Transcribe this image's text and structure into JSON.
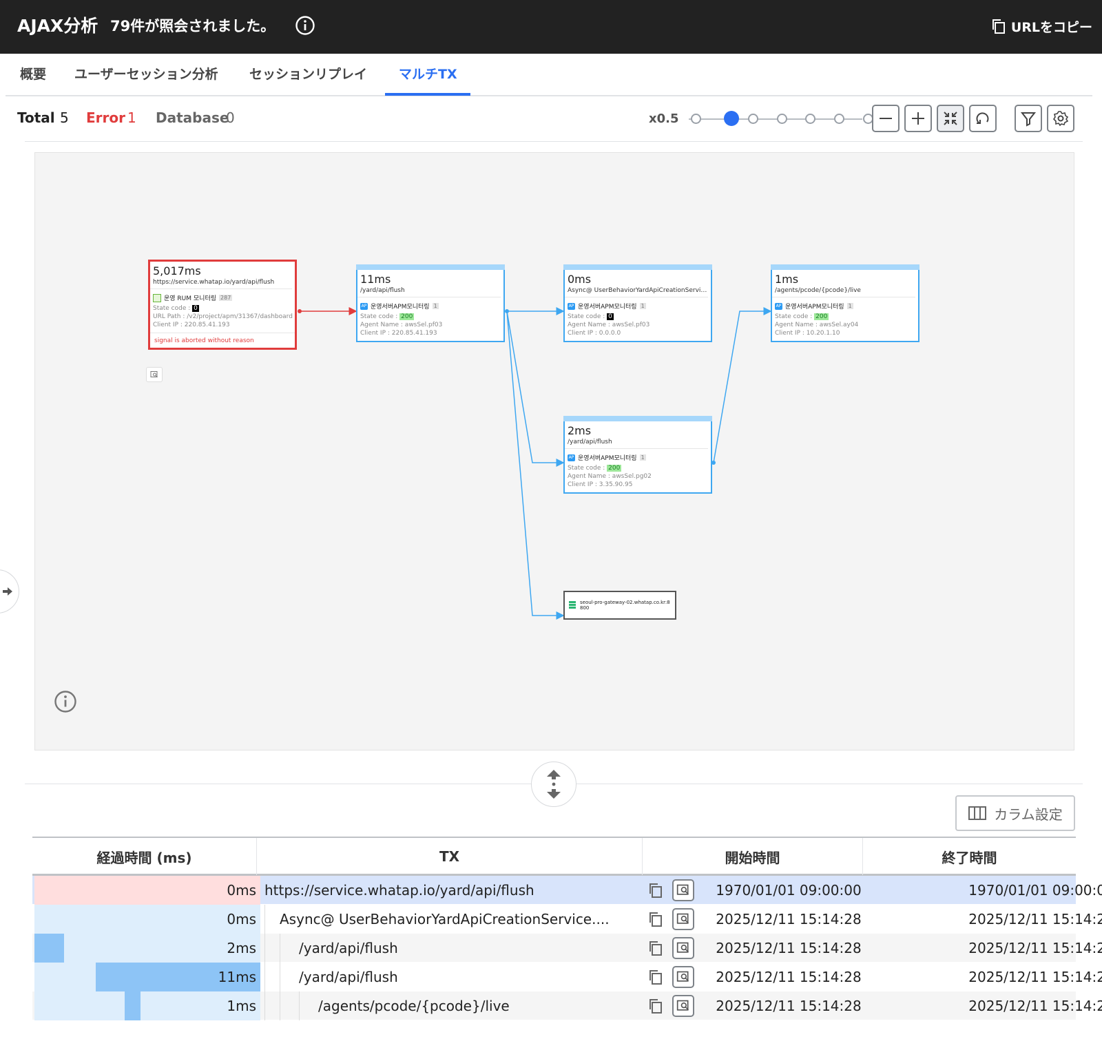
{
  "header": {
    "title": "AJAX分析",
    "subtitle": "79件が照会されました。",
    "copy_url_label": "URLをコピー"
  },
  "tabs": [
    {
      "label": "概要"
    },
    {
      "label": "ユーザーセッション分析"
    },
    {
      "label": "セッションリプレイ"
    },
    {
      "label": "マルチTX",
      "active": true
    }
  ],
  "stats": {
    "total_label": "Total",
    "total": "5",
    "error_label": "Error",
    "error": "1",
    "db_label": "Database",
    "db": "0"
  },
  "zoom": {
    "label": "x0.5",
    "steps": 7,
    "selected_index": 1
  },
  "graph": {
    "nodes": [
      {
        "duration": "5,017ms",
        "path": "https://service.whatap.io/yard/api/flush",
        "agent": "운영 RUM 모니터링",
        "count": "287",
        "state_label": "State code :",
        "state": "0",
        "url_path": "URL Path : /v2/project/apm/31367/dashboard",
        "client_ip": "Client IP : 220.85.41.193",
        "error_message": "signal is aborted without reason"
      },
      {
        "duration": "11ms",
        "path": "/yard/api/flush",
        "agent": "운영서버APM모니터링",
        "count": "1",
        "state_label": "State code :",
        "state": "200",
        "agent_name": "Agent Name : awsSel.pf03",
        "client_ip": "Client IP : 220.85.41.193"
      },
      {
        "duration": "0ms",
        "path": "Async@ UserBehaviorYardApiCreationServic...",
        "agent": "운영서버APM모니터링",
        "count": "1",
        "state_label": "State code :",
        "state": "0",
        "agent_name": "Agent Name : awsSel.pf03",
        "client_ip": "Client IP : 0.0.0.0"
      },
      {
        "duration": "1ms",
        "path": "/agents/pcode/{pcode}/live",
        "agent": "운영서버APM모니터링",
        "count": "1",
        "state_label": "State code :",
        "state": "200",
        "agent_name": "Agent Name : awsSel.ay04",
        "client_ip": "Client IP : 10.20.1.10"
      },
      {
        "duration": "2ms",
        "path": "/yard/api/flush",
        "agent": "운영서버APM모니터링",
        "count": "1",
        "state_label": "State code :",
        "state": "200",
        "agent_name": "Agent Name : awsSel.pg02",
        "client_ip": "Client IP : 3.35.90.95"
      }
    ],
    "gateway": {
      "line1": "seoul-pro-gateway-02.whatap.co.kr:8",
      "line2": "800"
    }
  },
  "column_setting_label": "カラム設定",
  "table": {
    "headers": [
      "経過時間 (ms)",
      "TX",
      "開始時間",
      "終了時間"
    ],
    "rows": [
      {
        "elapsed": "0ms",
        "tx": "https://service.whatap.io/yard/api/flush",
        "depth": 0,
        "start": "1970/01/01 09:00:00",
        "end": "1970/01/01 09:00:0",
        "bar": [
          0,
          0
        ]
      },
      {
        "elapsed": "0ms",
        "tx": "Async@ UserBehaviorYardApiCreationService....",
        "depth": 1,
        "start": "2025/12/11 15:14:28",
        "end": "2025/12/11 15:14:2",
        "bar": [
          0,
          0
        ]
      },
      {
        "elapsed": "2ms",
        "tx": "/yard/api/flush",
        "depth": 2,
        "start": "2025/12/11 15:14:28",
        "end": "2025/12/11 15:14:2",
        "bar": [
          0,
          0.13
        ]
      },
      {
        "elapsed": "11ms",
        "tx": "/yard/api/flush",
        "depth": 2,
        "start": "2025/12/11 15:14:28",
        "end": "2025/12/11 15:14:2",
        "bar": [
          0.27,
          1.0
        ]
      },
      {
        "elapsed": "1ms",
        "tx": "/agents/pcode/{pcode}/live",
        "depth": 3,
        "start": "2025/12/11 15:14:28",
        "end": "2025/12/11 15:14:2",
        "bar": [
          0.4,
          0.47
        ]
      }
    ]
  },
  "colors": {
    "accent": "#2b6ff2",
    "error": "#e03c3c",
    "edge": "#3ea7f1",
    "header_bg": "#222222"
  }
}
